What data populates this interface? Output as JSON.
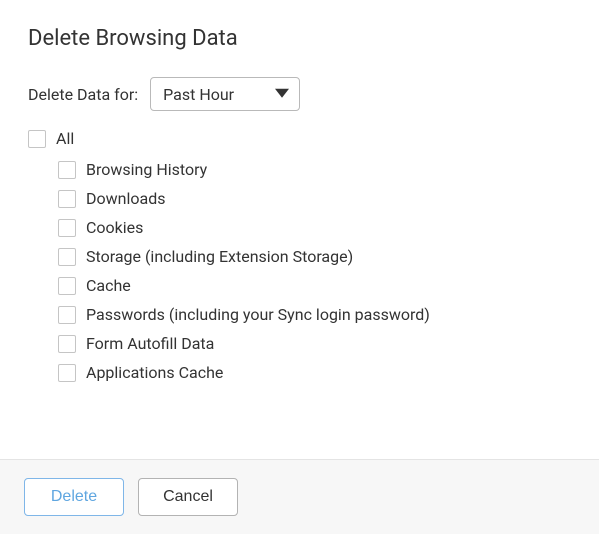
{
  "title": "Delete Browsing Data",
  "timeRange": {
    "label": "Delete Data for:",
    "selected": "Past Hour"
  },
  "allOption": {
    "label": "All",
    "checked": false
  },
  "items": [
    {
      "label": "Browsing History",
      "checked": false
    },
    {
      "label": "Downloads",
      "checked": false
    },
    {
      "label": "Cookies",
      "checked": false
    },
    {
      "label": "Storage (including Extension Storage)",
      "checked": false
    },
    {
      "label": "Cache",
      "checked": false
    },
    {
      "label": "Passwords (including your Sync login password)",
      "checked": false
    },
    {
      "label": "Form Autofill Data",
      "checked": false
    },
    {
      "label": "Applications Cache",
      "checked": false
    }
  ],
  "buttons": {
    "delete": "Delete",
    "cancel": "Cancel"
  }
}
